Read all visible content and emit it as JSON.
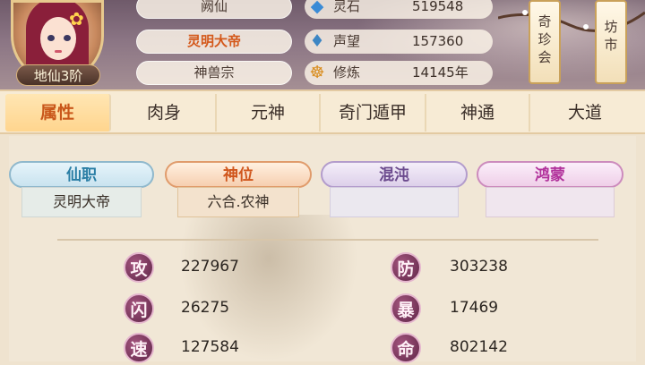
{
  "header": {
    "rank_badge": "地仙3阶",
    "name": "阙仙",
    "title": "灵明大帝",
    "sect": "神兽宗"
  },
  "resources": [
    {
      "icon": "spirit-stone-icon",
      "label": "灵石",
      "value": "519548"
    },
    {
      "icon": "prestige-icon",
      "label": "声望",
      "value": "157360"
    },
    {
      "icon": "cultivation-icon",
      "label": "修炼",
      "value": "14145年"
    }
  ],
  "side_buttons": {
    "treasure": [
      "奇",
      "珍",
      "会"
    ],
    "market": [
      "坊",
      "市"
    ]
  },
  "tabs": [
    "属性",
    "肉身",
    "元神",
    "奇门遁甲",
    "神通",
    "大道"
  ],
  "active_tab": 0,
  "titles": [
    {
      "label": "仙职",
      "value": "灵明大帝"
    },
    {
      "label": "神位",
      "value": "六合.农神"
    },
    {
      "label": "混沌",
      "value": ""
    },
    {
      "label": "鸿蒙",
      "value": ""
    }
  ],
  "stats": [
    {
      "char": "攻",
      "value": "227967"
    },
    {
      "char": "防",
      "value": "303238"
    },
    {
      "char": "闪",
      "value": "26275"
    },
    {
      "char": "暴",
      "value": "17469"
    },
    {
      "char": "速",
      "value": "127584"
    },
    {
      "char": "命",
      "value": "802142"
    }
  ],
  "colors": {
    "accent_orange": "#d4581a",
    "stat_icon": "#7a3558",
    "panel_bg": "#f1e7d6"
  }
}
